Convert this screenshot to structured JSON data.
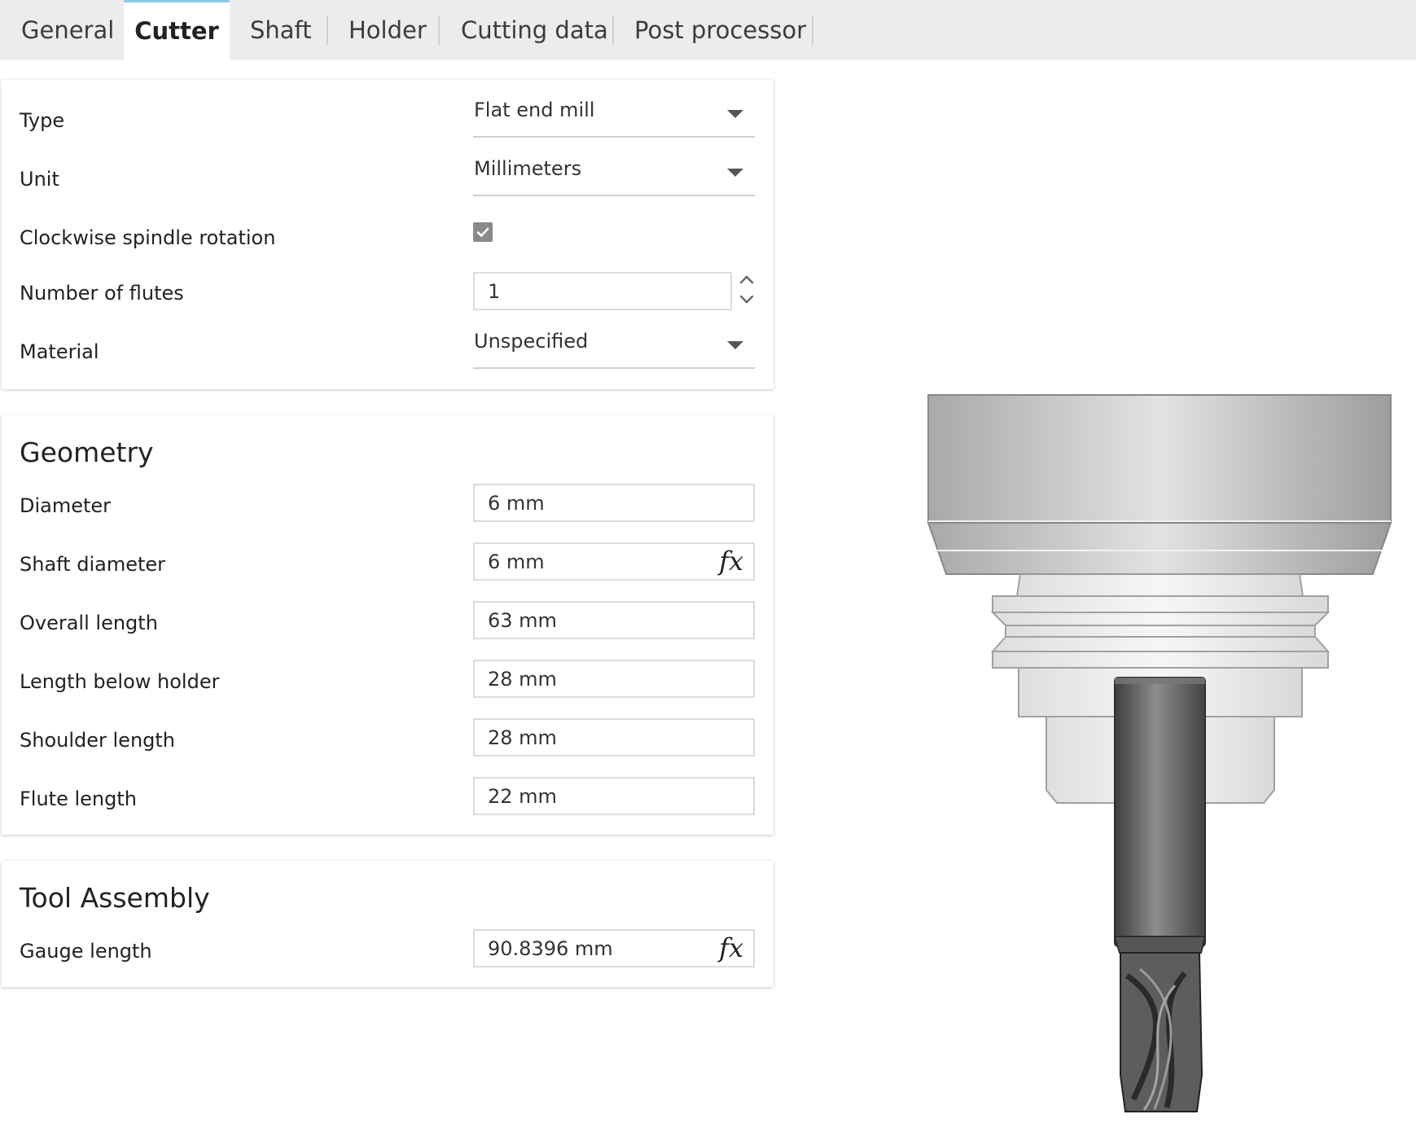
{
  "tabs": [
    "General",
    "Cutter",
    "Shaft",
    "Holder",
    "Cutting data",
    "Post processor"
  ],
  "active_tab": "Cutter",
  "cutter": {
    "type_label": "Type",
    "type_value": "Flat end mill",
    "unit_label": "Unit",
    "unit_value": "Millimeters",
    "clockwise_label": "Clockwise spindle rotation",
    "clockwise_checked": true,
    "flutes_label": "Number of flutes",
    "flutes_value": "1",
    "material_label": "Material",
    "material_value": "Unspecified"
  },
  "geometry": {
    "title": "Geometry",
    "diameter_label": "Diameter",
    "diameter_value": "6 mm",
    "shaft_diameter_label": "Shaft diameter",
    "shaft_diameter_value": "6 mm",
    "overall_length_label": "Overall length",
    "overall_length_value": "63 mm",
    "length_below_holder_label": "Length below holder",
    "length_below_holder_value": "28 mm",
    "shoulder_length_label": "Shoulder length",
    "shoulder_length_value": "28 mm",
    "flute_length_label": "Flute length",
    "flute_length_value": "22 mm"
  },
  "assembly": {
    "title": "Tool Assembly",
    "gauge_length_label": "Gauge length",
    "gauge_length_value": "90.8396 mm"
  },
  "fx_symbol": "fx",
  "colors": {
    "accent": "#8ec8e8",
    "tabbar": "#ececec"
  }
}
